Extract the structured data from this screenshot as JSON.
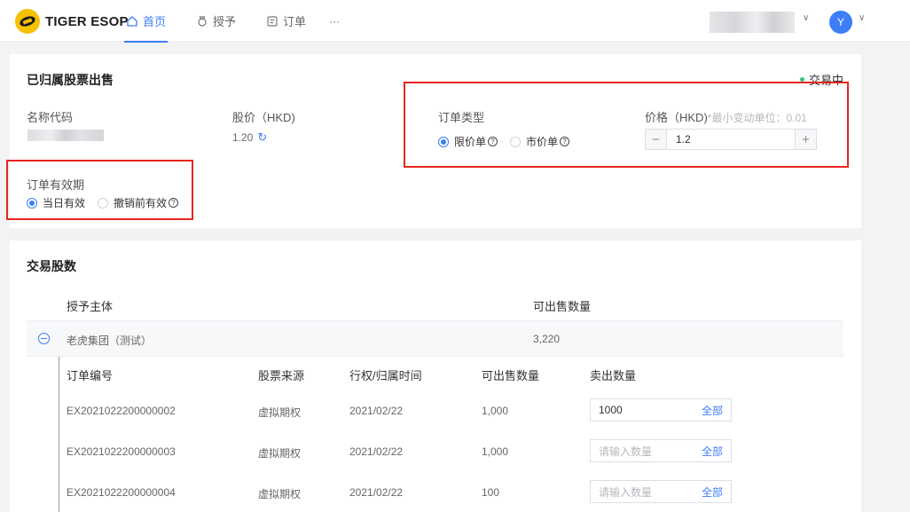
{
  "header": {
    "logo_text": "TIGER ESOP",
    "nav": [
      {
        "label": "首页",
        "icon": "home-icon",
        "active": true
      },
      {
        "label": "授予",
        "icon": "award-icon",
        "active": false
      },
      {
        "label": "订单",
        "icon": "order-icon",
        "active": false
      }
    ],
    "more": "···",
    "avatar_letter": "Y"
  },
  "sell": {
    "title": "已归属股票出售",
    "status": "交易中",
    "name_code_label": "名称代码",
    "price_label": "股价（HKD)",
    "price_value": "1.20",
    "order_type_label": "订单类型",
    "order_types": [
      {
        "label": "限价单",
        "selected": true
      },
      {
        "label": "市价单",
        "selected": false
      }
    ],
    "limit_price_label": "价格（HKD)",
    "limit_price_hint": "*最小变动单位：0.01",
    "limit_price_value": "1.2",
    "validity_label": "订单有效期",
    "validity_options": [
      {
        "label": "当日有效",
        "selected": true
      },
      {
        "label": "撤销前有效",
        "selected": false
      }
    ]
  },
  "shares": {
    "title": "交易股数",
    "col_entity": "授予主体",
    "col_sellable": "可出售数量",
    "group": {
      "name": "老虎集团（测试）",
      "sellable": "3,220"
    },
    "sub_columns": [
      "订单编号",
      "股票来源",
      "行权/归属时间",
      "可出售数量",
      "卖出数量"
    ],
    "rows": [
      {
        "order_no": "EX2021022200000002",
        "source": "虚拟期权",
        "date": "2021/02/22",
        "sellable": "1,000",
        "qty": "1000",
        "placeholder": "请输入数量",
        "all": "全部"
      },
      {
        "order_no": "EX2021022200000003",
        "source": "虚拟期权",
        "date": "2021/02/22",
        "sellable": "1,000",
        "qty": "",
        "placeholder": "请输入数量",
        "all": "全部"
      },
      {
        "order_no": "EX2021022200000004",
        "source": "虚拟期权",
        "date": "2021/02/22",
        "sellable": "100",
        "qty": "",
        "placeholder": "请输入数量",
        "all": "全部"
      }
    ]
  },
  "colors": {
    "accent": "#3d7ef6",
    "highlight": "#e8251e",
    "status": "#35c37d"
  }
}
